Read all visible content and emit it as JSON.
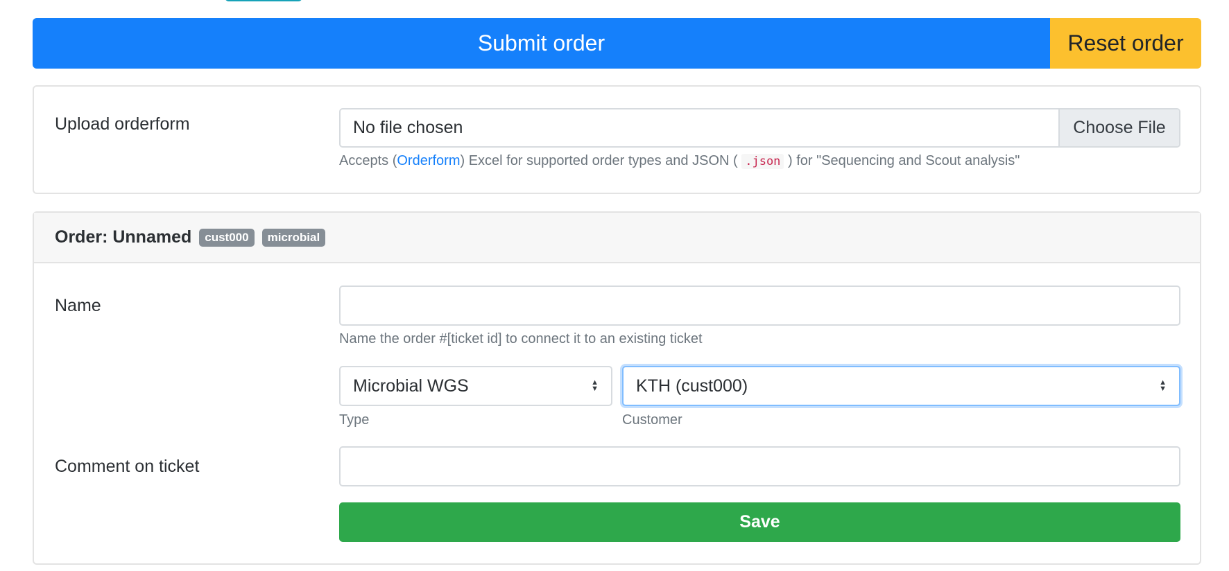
{
  "actions": {
    "submit_label": "Submit order",
    "reset_label": "Reset order"
  },
  "upload": {
    "label": "Upload orderform",
    "file_status": "No file chosen",
    "choose_button": "Choose File",
    "help_prefix": "Accepts (",
    "help_link": "Orderform",
    "help_mid": ") Excel for supported order types and JSON (",
    "help_code": ".json",
    "help_suffix": ") for \"Sequencing and Scout analysis\""
  },
  "order": {
    "title": "Order: Unnamed",
    "badges": [
      "cust000",
      "microbial"
    ],
    "name_label": "Name",
    "name_value": "",
    "name_help": "Name the order #[ticket id] to connect it to an existing ticket",
    "type_value": "Microbial WGS",
    "type_label": "Type",
    "customer_value": "KTH (cust000)",
    "customer_label": "Customer",
    "comment_label": "Comment on ticket",
    "comment_value": "",
    "save_label": "Save"
  },
  "colors": {
    "primary": "#1580fb",
    "warning": "#fcc02e",
    "success": "#2ea84b",
    "badge": "#868e96",
    "focus": "#80bdff"
  }
}
